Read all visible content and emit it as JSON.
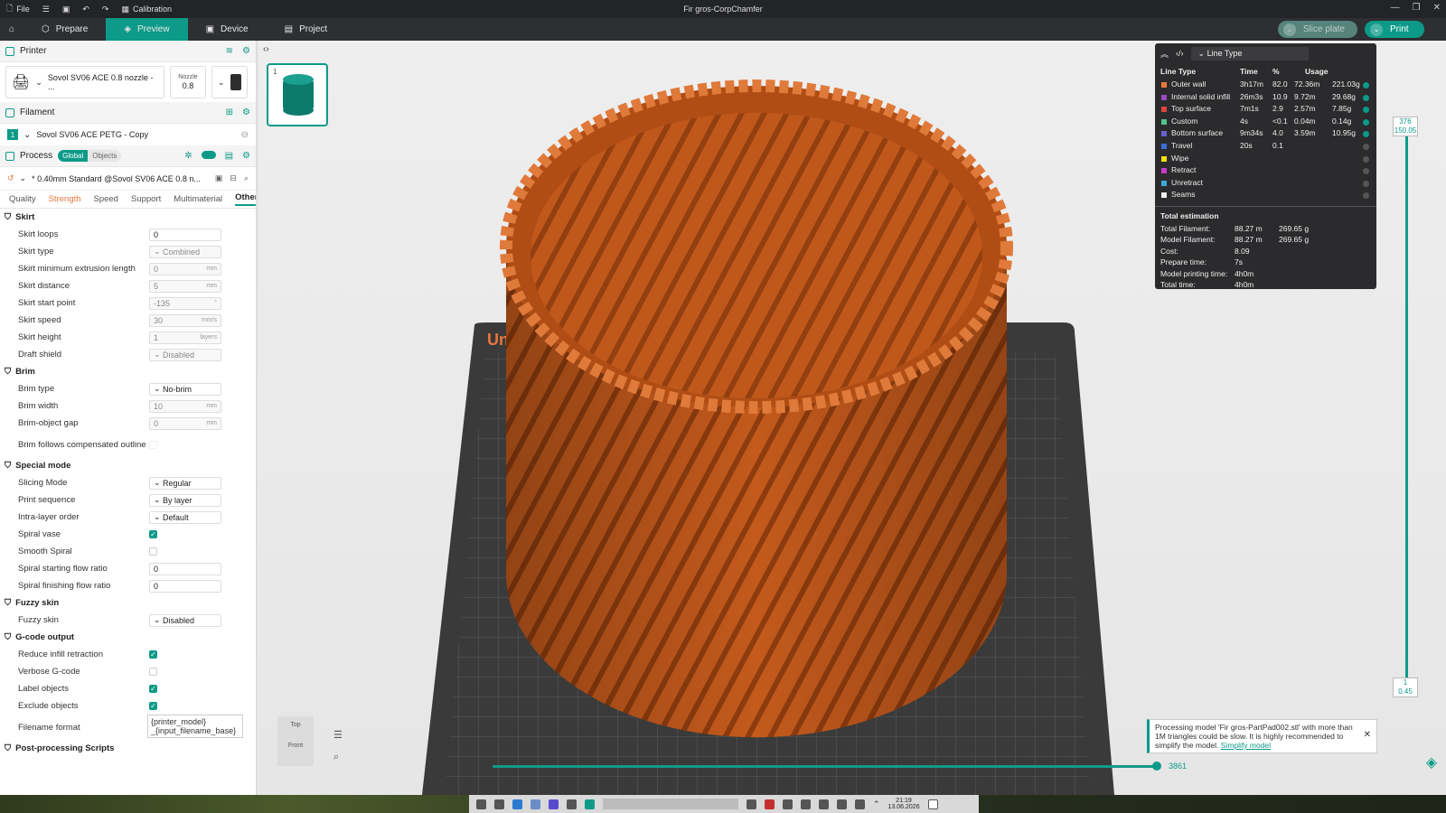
{
  "titlebar": {
    "file": "File",
    "calibration": "Calibration",
    "title": "Fir gros-CorpChamfer"
  },
  "tabs": [
    {
      "label": "Prepare"
    },
    {
      "label": "Preview"
    },
    {
      "label": "Device"
    },
    {
      "label": "Project"
    }
  ],
  "actions": {
    "slice": "Slice plate",
    "print": "Print"
  },
  "printer": {
    "title": "Printer",
    "name": "Sovol SV06 ACE 0.8 nozzle - ...",
    "nozzle_label": "Nozzle",
    "nozzle_value": "0.8"
  },
  "filament": {
    "title": "Filament",
    "slot": "1",
    "name": "Sovol SV06 ACE PETG - Copy"
  },
  "process": {
    "title": "Process",
    "global": "Global",
    "objects": "Objects",
    "preset": "* 0.40mm Standard @Sovol SV06 ACE 0.8 n...",
    "tabs": [
      "Quality",
      "Strength",
      "Speed",
      "Support",
      "Multimaterial",
      "Others"
    ]
  },
  "settings": {
    "skirt": {
      "title": "Skirt",
      "loops_l": "Skirt loops",
      "loops_v": "0",
      "type_l": "Skirt type",
      "type_v": "Combined",
      "minext_l": "Skirt minimum extrusion length",
      "minext_v": "0",
      "dist_l": "Skirt distance",
      "dist_v": "5",
      "start_l": "Skirt start point",
      "start_v": "-135",
      "speed_l": "Skirt speed",
      "speed_v": "30",
      "height_l": "Skirt height",
      "height_v": "1",
      "draft_l": "Draft shield",
      "draft_v": "Disabled"
    },
    "brim": {
      "title": "Brim",
      "type_l": "Brim type",
      "type_v": "No-brim",
      "width_l": "Brim width",
      "width_v": "10",
      "gap_l": "Brim-object gap",
      "gap_v": "0",
      "follow_l": "Brim follows compensated outline"
    },
    "special": {
      "title": "Special mode",
      "slicing_l": "Slicing Mode",
      "slicing_v": "Regular",
      "seq_l": "Print sequence",
      "seq_v": "By layer",
      "intra_l": "Intra-layer order",
      "intra_v": "Default",
      "spiral_l": "Spiral vase",
      "smooth_l": "Smooth Spiral",
      "sflow_l": "Spiral starting flow ratio",
      "sflow_v": "0",
      "fflow_l": "Spiral finishing flow ratio",
      "fflow_v": "0"
    },
    "fuzzy": {
      "title": "Fuzzy skin",
      "fuzzy_l": "Fuzzy skin",
      "fuzzy_v": "Disabled"
    },
    "gcode": {
      "title": "G-code output",
      "reduce_l": "Reduce infill retraction",
      "verbose_l": "Verbose G-code",
      "label_l": "Label objects",
      "exclude_l": "Exclude objects",
      "fname_l": "Filename format",
      "fname_v": "{printer_model}\n_{input_filename_base}"
    },
    "post": {
      "title": "Post-processing Scripts"
    },
    "units": {
      "mm": "mm",
      "mms": "mm/s",
      "layers": "layers",
      "deg": "°"
    }
  },
  "plate": {
    "number": "1"
  },
  "legend": {
    "selector": "Line Type",
    "headers": {
      "type": "Line Type",
      "time": "Time",
      "pct": "%",
      "usage": "Usage"
    },
    "rows": [
      {
        "name": "Outer wall",
        "color": "#e8773d",
        "time": "3h17m",
        "pct": "82.0",
        "len": "72.36m",
        "wt": "221.03g"
      },
      {
        "name": "Internal solid infill",
        "color": "#9b49c5",
        "time": "26m3s",
        "pct": "10.9",
        "len": "9.72m",
        "wt": "29.68g"
      },
      {
        "name": "Top surface",
        "color": "#e0453b",
        "time": "7m1s",
        "pct": "2.9",
        "len": "2.57m",
        "wt": "7.85g"
      },
      {
        "name": "Custom",
        "color": "#4ec48a",
        "time": "4s",
        "pct": "<0.1",
        "len": "0.04m",
        "wt": "0.14g"
      },
      {
        "name": "Bottom surface",
        "color": "#6b5fd1",
        "time": "9m34s",
        "pct": "4.0",
        "len": "3.59m",
        "wt": "10.95g"
      },
      {
        "name": "Travel",
        "color": "#3b6ed9",
        "time": "20s",
        "pct": "0.1",
        "len": "",
        "wt": ""
      },
      {
        "name": "Wipe",
        "color": "#f2e012",
        "time": "",
        "pct": "",
        "len": "",
        "wt": ""
      },
      {
        "name": "Retract",
        "color": "#c83ac8",
        "time": "",
        "pct": "",
        "len": "",
        "wt": ""
      },
      {
        "name": "Unretract",
        "color": "#3aa8d6",
        "time": "",
        "pct": "",
        "len": "",
        "wt": ""
      },
      {
        "name": "Seams",
        "color": "#f0f0f0",
        "time": "",
        "pct": "",
        "len": "",
        "wt": ""
      }
    ],
    "estimation": {
      "title": "Total estimation",
      "rows": [
        {
          "k": "Total Filament:",
          "a": "88.27 m",
          "b": "269.65 g"
        },
        {
          "k": "Model Filament:",
          "a": "88.27 m",
          "b": "269.65 g"
        },
        {
          "k": "Cost:",
          "a": "8.09",
          "b": ""
        },
        {
          "k": "Prepare time:",
          "a": "7s",
          "b": ""
        },
        {
          "k": "Model printing time:",
          "a": "4h0m",
          "b": ""
        },
        {
          "k": "Total time:",
          "a": "4h0m",
          "b": ""
        }
      ]
    }
  },
  "vslider": {
    "top_layer": "376",
    "top_height": "150.05",
    "bottom_layer": "1",
    "bottom_height": "0.45"
  },
  "hslider": {
    "value": "3861"
  },
  "viewcube": {
    "top": "Top",
    "front": "Front"
  },
  "notification": {
    "text": "Processing model 'Fir gros-PartPad002.stl' with more than 1M triangles could be slow. It is highly recommended to simplify the model.",
    "link": "Simplify model"
  },
  "bed_text": "Un",
  "taskbar": {
    "time": "21:19",
    "date": "13.06.2026"
  },
  "colors": {
    "accent": "#0d9a88",
    "model": "#c45a1c"
  }
}
